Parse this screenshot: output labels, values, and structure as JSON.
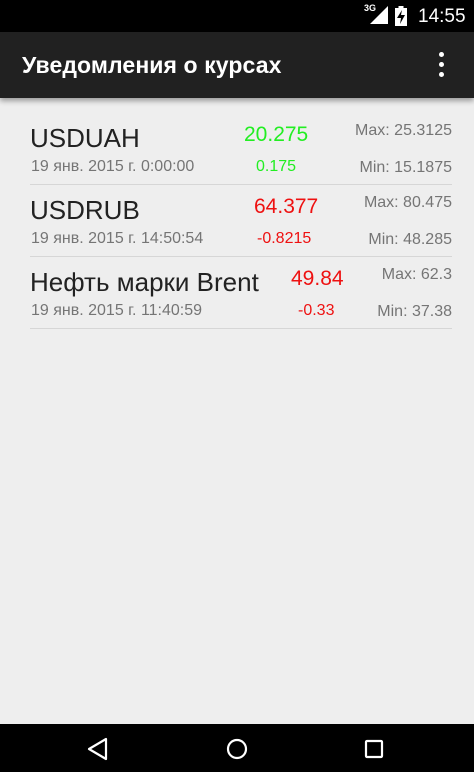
{
  "status_bar": {
    "network": "3G",
    "time": "14:55",
    "icons": [
      "signal-icon",
      "battery-charging-icon"
    ]
  },
  "app_bar": {
    "title": "Уведомления о курсах",
    "menu_icon": "overflow-menu-icon"
  },
  "rates": [
    {
      "name": "USDUAH",
      "date": "19 янв. 2015 г. 0:00:00",
      "value": "20.275",
      "change": "0.175",
      "max": "Max: 25.3125",
      "min": "Min: 15.1875",
      "trend_color": "#22ee22"
    },
    {
      "name": "USDRUB",
      "date": "19 янв. 2015 г. 14:50:54",
      "value": "64.377",
      "change": "-0.8215",
      "max": "Max: 80.475",
      "min": "Min: 48.285",
      "trend_color": "#ee1111"
    },
    {
      "name": "Нефть марки Brent",
      "date": "19 янв. 2015 г. 11:40:59",
      "value": "49.84",
      "change": "-0.33",
      "max": "Max: 62.3",
      "min": "Min: 37.38",
      "trend_color": "#ee1111"
    }
  ],
  "nav_bar": {
    "icons": [
      "back-icon",
      "home-icon",
      "recents-icon"
    ]
  },
  "colors": {
    "app_bar": "#212121",
    "background": "#eeeeee",
    "up": "#22ee22",
    "down": "#ee1111"
  }
}
